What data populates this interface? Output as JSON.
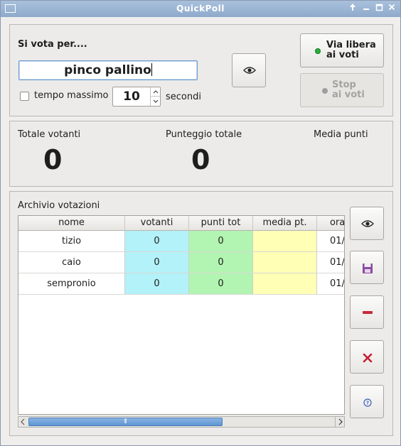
{
  "window": {
    "title": "QuickPoll",
    "controls": {
      "sysmenu": "window-menu-icon",
      "up": "▲",
      "minimize": "−",
      "maximize": "□",
      "close": "✕"
    }
  },
  "voting": {
    "label": "Si vota per....",
    "name_value": "pinco pallino",
    "max_time_label": "tempo massimo",
    "max_time_checked": false,
    "seconds_value": "10",
    "seconds_label": "secondi",
    "start_button": {
      "line1": "Via libera",
      "line2": "ai voti"
    },
    "stop_button": {
      "line1": "Stop",
      "line2": "ai voti"
    },
    "start_led_color": "#28b03a",
    "stop_led_color": "#9e9e9e"
  },
  "stats": {
    "total_voters_label": "Totale votanti",
    "total_voters_value": "0",
    "total_points_label": "Punteggio totale",
    "total_points_value": "0",
    "avg_points_label": "Media punti",
    "avg_points_value": ""
  },
  "archive": {
    "label": "Archivio votazioni",
    "columns": [
      "nome",
      "votanti",
      "punti tot",
      "media pt.",
      "ora"
    ],
    "rows": [
      {
        "nome": "tizio",
        "votanti": "0",
        "punti": "0",
        "media": "",
        "ora": "01/"
      },
      {
        "nome": "caio",
        "votanti": "0",
        "punti": "0",
        "media": "",
        "ora": "01/"
      },
      {
        "nome": "sempronio",
        "votanti": "0",
        "punti": "0",
        "media": "",
        "ora": "01/"
      }
    ],
    "column_colors": {
      "votanti": "#b3f2f8",
      "punti": "#b2f4b1",
      "media": "#ffffb6"
    },
    "scroll_thumb_symbol": "⦀"
  }
}
